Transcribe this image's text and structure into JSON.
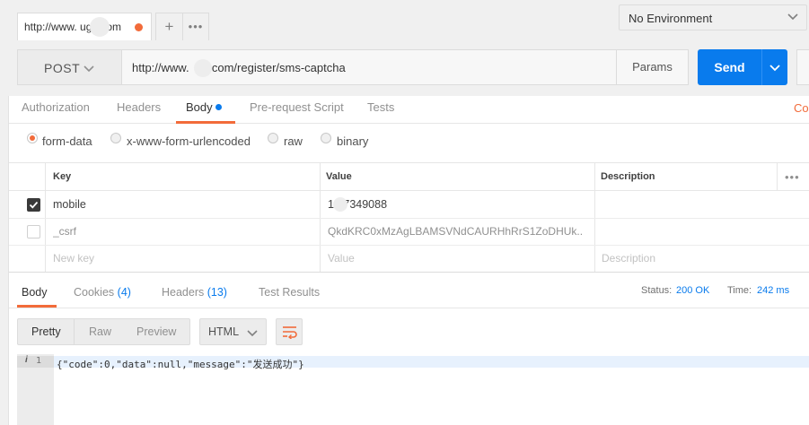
{
  "tabs": {
    "request_tab_label": "http://www.  ugg.com",
    "new_tab_label": "+",
    "more_tabs_label": "•••"
  },
  "environment": {
    "selected": "No Environment"
  },
  "request": {
    "method": "POST",
    "url": "http://www.  gg.com/register/sms-captcha",
    "params_label": "Params",
    "send_label": "Send"
  },
  "request_tabs": {
    "authorization": "Authorization",
    "headers": "Headers",
    "body": "Body",
    "pre_request_script": "Pre-request Script",
    "tests": "Tests",
    "code": "Code"
  },
  "body_types": {
    "form_data": "form-data",
    "urlencoded": "x-www-form-urlencoded",
    "raw": "raw",
    "binary": "binary",
    "selected": "form-data"
  },
  "params_table": {
    "headers": {
      "key": "Key",
      "value": "Value",
      "description": "Description"
    },
    "more_label": "•••",
    "rows": [
      {
        "checked": true,
        "key": "mobile",
        "value": "1  87349088",
        "description": ""
      },
      {
        "checked": false,
        "key": "_csrf",
        "value": "QkdKRC0xMzAgLBAMSVNdCAURHhRrS1ZoDHUk...",
        "description": ""
      }
    ],
    "new_row": {
      "key_placeholder": "New key",
      "value_placeholder": "Value",
      "description_placeholder": "Description"
    }
  },
  "response": {
    "tabs": {
      "body": "Body",
      "cookies": "Cookies",
      "cookies_count": "(4)",
      "headers": "Headers",
      "headers_count": "(13)",
      "test_results": "Test Results"
    },
    "status_label": "Status:",
    "status_value": "200 OK",
    "time_label": "Time:",
    "time_value": "242 ms",
    "view_modes": {
      "pretty": "Pretty",
      "raw": "Raw",
      "preview": "Preview",
      "selected": "Pretty"
    },
    "format": "HTML",
    "editor": {
      "line_number": "1",
      "info_glyph": "i",
      "content": "{\"code\":0,\"data\":null,\"message\":\"发送成功\"}"
    }
  },
  "colors": {
    "accent_orange": "#f26b3a",
    "send_blue": "#097bed",
    "status_blue": "#097bed"
  },
  "icons": [
    "chevron-down-icon",
    "wrap-lines-icon",
    "checkmark-icon",
    "info-icon"
  ]
}
